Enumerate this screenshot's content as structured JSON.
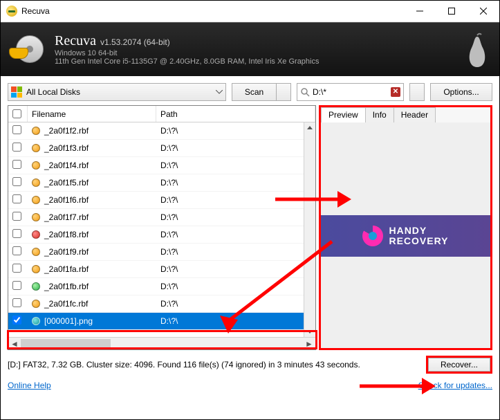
{
  "window": {
    "title": "Recuva"
  },
  "header": {
    "name": "Recuva",
    "version": "v1.53.2074 (64-bit)",
    "os": "Windows 10 64-bit",
    "hw": "11th Gen Intel Core i5-1135G7 @ 2.40GHz, 8.0GB RAM, Intel Iris Xe Graphics"
  },
  "toolbar": {
    "drive": "All Local Disks",
    "scan_label": "Scan",
    "path_value": "D:\\*",
    "options_label": "Options..."
  },
  "columns": {
    "filename": "Filename",
    "path": "Path"
  },
  "files": [
    {
      "checked": false,
      "status": "orange",
      "name": "_2a0f1f2.rbf",
      "path": "D:\\?\\"
    },
    {
      "checked": false,
      "status": "orange",
      "name": "_2a0f1f3.rbf",
      "path": "D:\\?\\"
    },
    {
      "checked": false,
      "status": "orange",
      "name": "_2a0f1f4.rbf",
      "path": "D:\\?\\"
    },
    {
      "checked": false,
      "status": "orange",
      "name": "_2a0f1f5.rbf",
      "path": "D:\\?\\"
    },
    {
      "checked": false,
      "status": "orange",
      "name": "_2a0f1f6.rbf",
      "path": "D:\\?\\"
    },
    {
      "checked": false,
      "status": "orange",
      "name": "_2a0f1f7.rbf",
      "path": "D:\\?\\"
    },
    {
      "checked": false,
      "status": "red",
      "name": "_2a0f1f8.rbf",
      "path": "D:\\?\\"
    },
    {
      "checked": false,
      "status": "orange",
      "name": "_2a0f1f9.rbf",
      "path": "D:\\?\\"
    },
    {
      "checked": false,
      "status": "orange",
      "name": "_2a0f1fa.rbf",
      "path": "D:\\?\\"
    },
    {
      "checked": false,
      "status": "green",
      "name": "_2a0f1fb.rbf",
      "path": "D:\\?\\"
    },
    {
      "checked": false,
      "status": "orange",
      "name": "_2a0f1fc.rbf",
      "path": "D:\\?\\"
    },
    {
      "checked": true,
      "status": "teal",
      "name": "[000001].png",
      "path": "D:\\?\\",
      "selected": true
    }
  ],
  "tabs": {
    "preview": "Preview",
    "info": "Info",
    "header": "Header"
  },
  "ad": {
    "line1": "HANDY",
    "line2": "RECOVERY"
  },
  "status": "[D:] FAT32, 7.32 GB. Cluster size: 4096. Found 116 file(s) (74 ignored) in 3 minutes 43 seconds.",
  "recover_label": "Recover...",
  "links": {
    "help": "Online Help",
    "update": "Check for updates..."
  }
}
